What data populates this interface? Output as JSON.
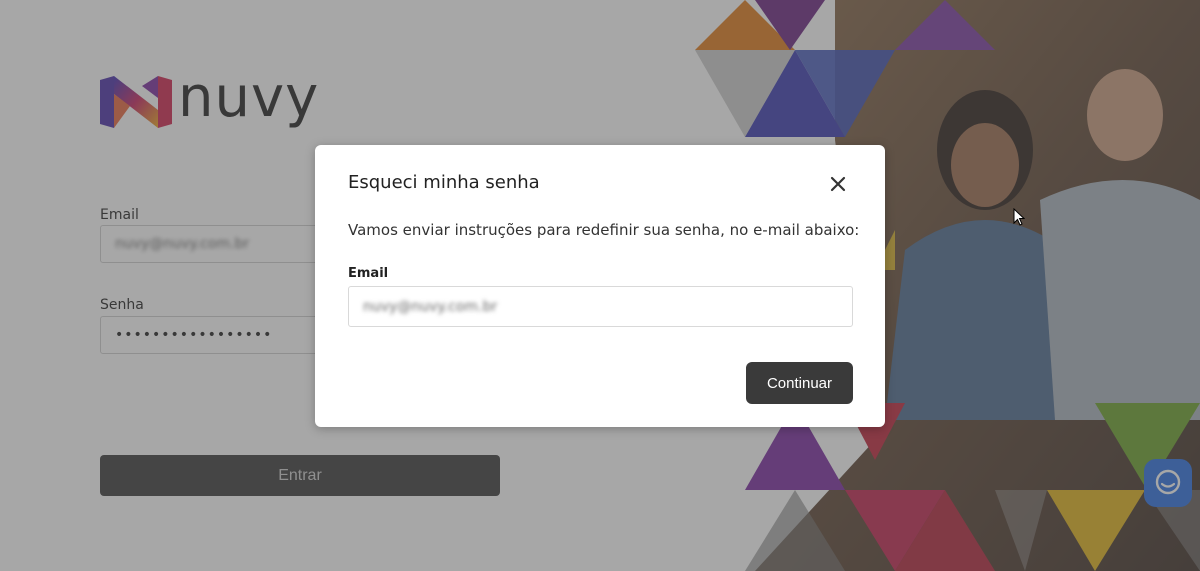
{
  "brand": {
    "name": "nuvy"
  },
  "login": {
    "email_label": "Email",
    "email_value": "nuvy@nuvy.com.br",
    "password_label": "Senha",
    "password_value": "•••••••••••••••••",
    "submit_label": "Entrar"
  },
  "modal": {
    "title": "Esqueci minha senha",
    "description": "Vamos enviar instruções para redefinir sua senha, no e-mail abaixo:",
    "email_label": "Email",
    "email_value": "nuvy@nuvy.com.br",
    "continue_label": "Continuar",
    "close_icon": "close-icon"
  },
  "chat": {
    "icon": "chat-icon",
    "color": "#2a6fe0"
  },
  "colors": {
    "button_dark": "#3a3a3a",
    "overlay": "rgba(80,80,80,0.5)",
    "logo_gradient": [
      "#3b2fb5",
      "#c8255e",
      "#f0a81c"
    ]
  }
}
